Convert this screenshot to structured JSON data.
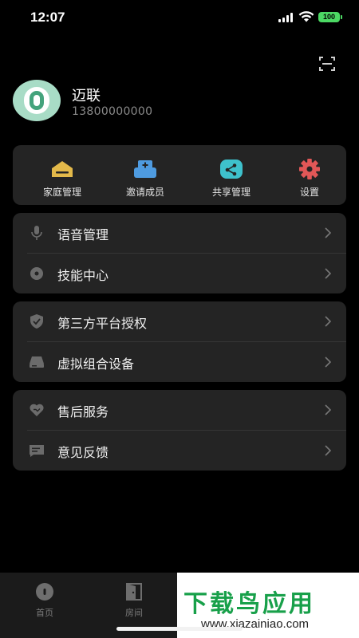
{
  "status_bar": {
    "time": "12:07",
    "battery": "100"
  },
  "profile": {
    "name": "迈联",
    "phone": "13800000000"
  },
  "quick_actions": [
    {
      "label": "家庭管理",
      "icon": "home-icon",
      "color": "#e3b94a"
    },
    {
      "label": "邀请成员",
      "icon": "invite-member-icon",
      "color": "#4e9be0"
    },
    {
      "label": "共享管理",
      "icon": "share-icon",
      "color": "#3ec1cc"
    },
    {
      "label": "设置",
      "icon": "gear-icon",
      "color": "#e25757"
    }
  ],
  "menu_groups": [
    {
      "items": [
        {
          "label": "语音管理",
          "icon": "microphone-icon"
        },
        {
          "label": "技能中心",
          "icon": "skill-icon"
        }
      ]
    },
    {
      "items": [
        {
          "label": "第三方平台授权",
          "icon": "shield-check-icon"
        },
        {
          "label": "虚拟组合设备",
          "icon": "device-icon"
        }
      ]
    },
    {
      "items": [
        {
          "label": "售后服务",
          "icon": "heart-handshake-icon"
        },
        {
          "label": "意见反馈",
          "icon": "feedback-icon"
        }
      ]
    }
  ],
  "tab_bar": {
    "tabs": [
      {
        "label": "首页",
        "icon": "home-tab-icon"
      },
      {
        "label": "房间",
        "icon": "room-tab-icon"
      }
    ]
  },
  "watermark": {
    "title": "下载鸟应用",
    "url": "www.xiazainiao.com"
  }
}
